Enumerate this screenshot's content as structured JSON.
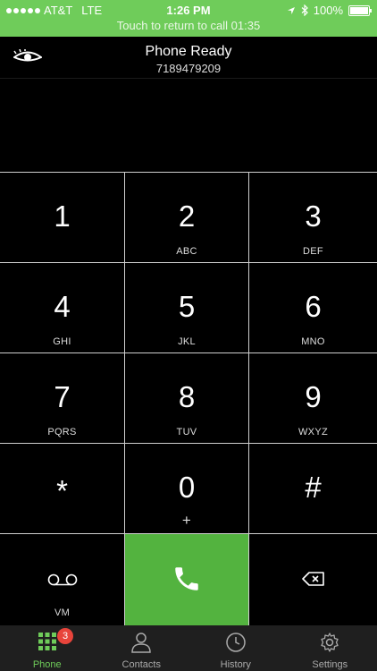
{
  "status_bar": {
    "carrier": "AT&T",
    "network": "LTE",
    "time": "1:26 PM",
    "battery": "100%",
    "battery_level": 1.0,
    "call_banner": "Touch to return to call 01:35"
  },
  "header": {
    "title": "Phone Ready",
    "number": "7189479209",
    "logo_icon": "eye-logo-icon"
  },
  "keypad": {
    "keys": [
      {
        "num": "1",
        "sub": ""
      },
      {
        "num": "2",
        "sub": "ABC"
      },
      {
        "num": "3",
        "sub": "DEF"
      },
      {
        "num": "4",
        "sub": "GHI"
      },
      {
        "num": "5",
        "sub": "JKL"
      },
      {
        "num": "6",
        "sub": "MNO"
      },
      {
        "num": "7",
        "sub": "PQRS"
      },
      {
        "num": "8",
        "sub": "TUV"
      },
      {
        "num": "9",
        "sub": "WXYZ"
      },
      {
        "num": "*",
        "sub": ""
      },
      {
        "num": "0",
        "sub": "+"
      },
      {
        "num": "#",
        "sub": ""
      }
    ],
    "voicemail_label": "VM"
  },
  "tabs": {
    "phone": "Phone",
    "contacts": "Contacts",
    "history": "History",
    "settings": "Settings",
    "phone_badge": "3"
  },
  "colors": {
    "accent": "#6fcc5a",
    "call_button": "#53b33f",
    "badge": "#e8443b"
  }
}
